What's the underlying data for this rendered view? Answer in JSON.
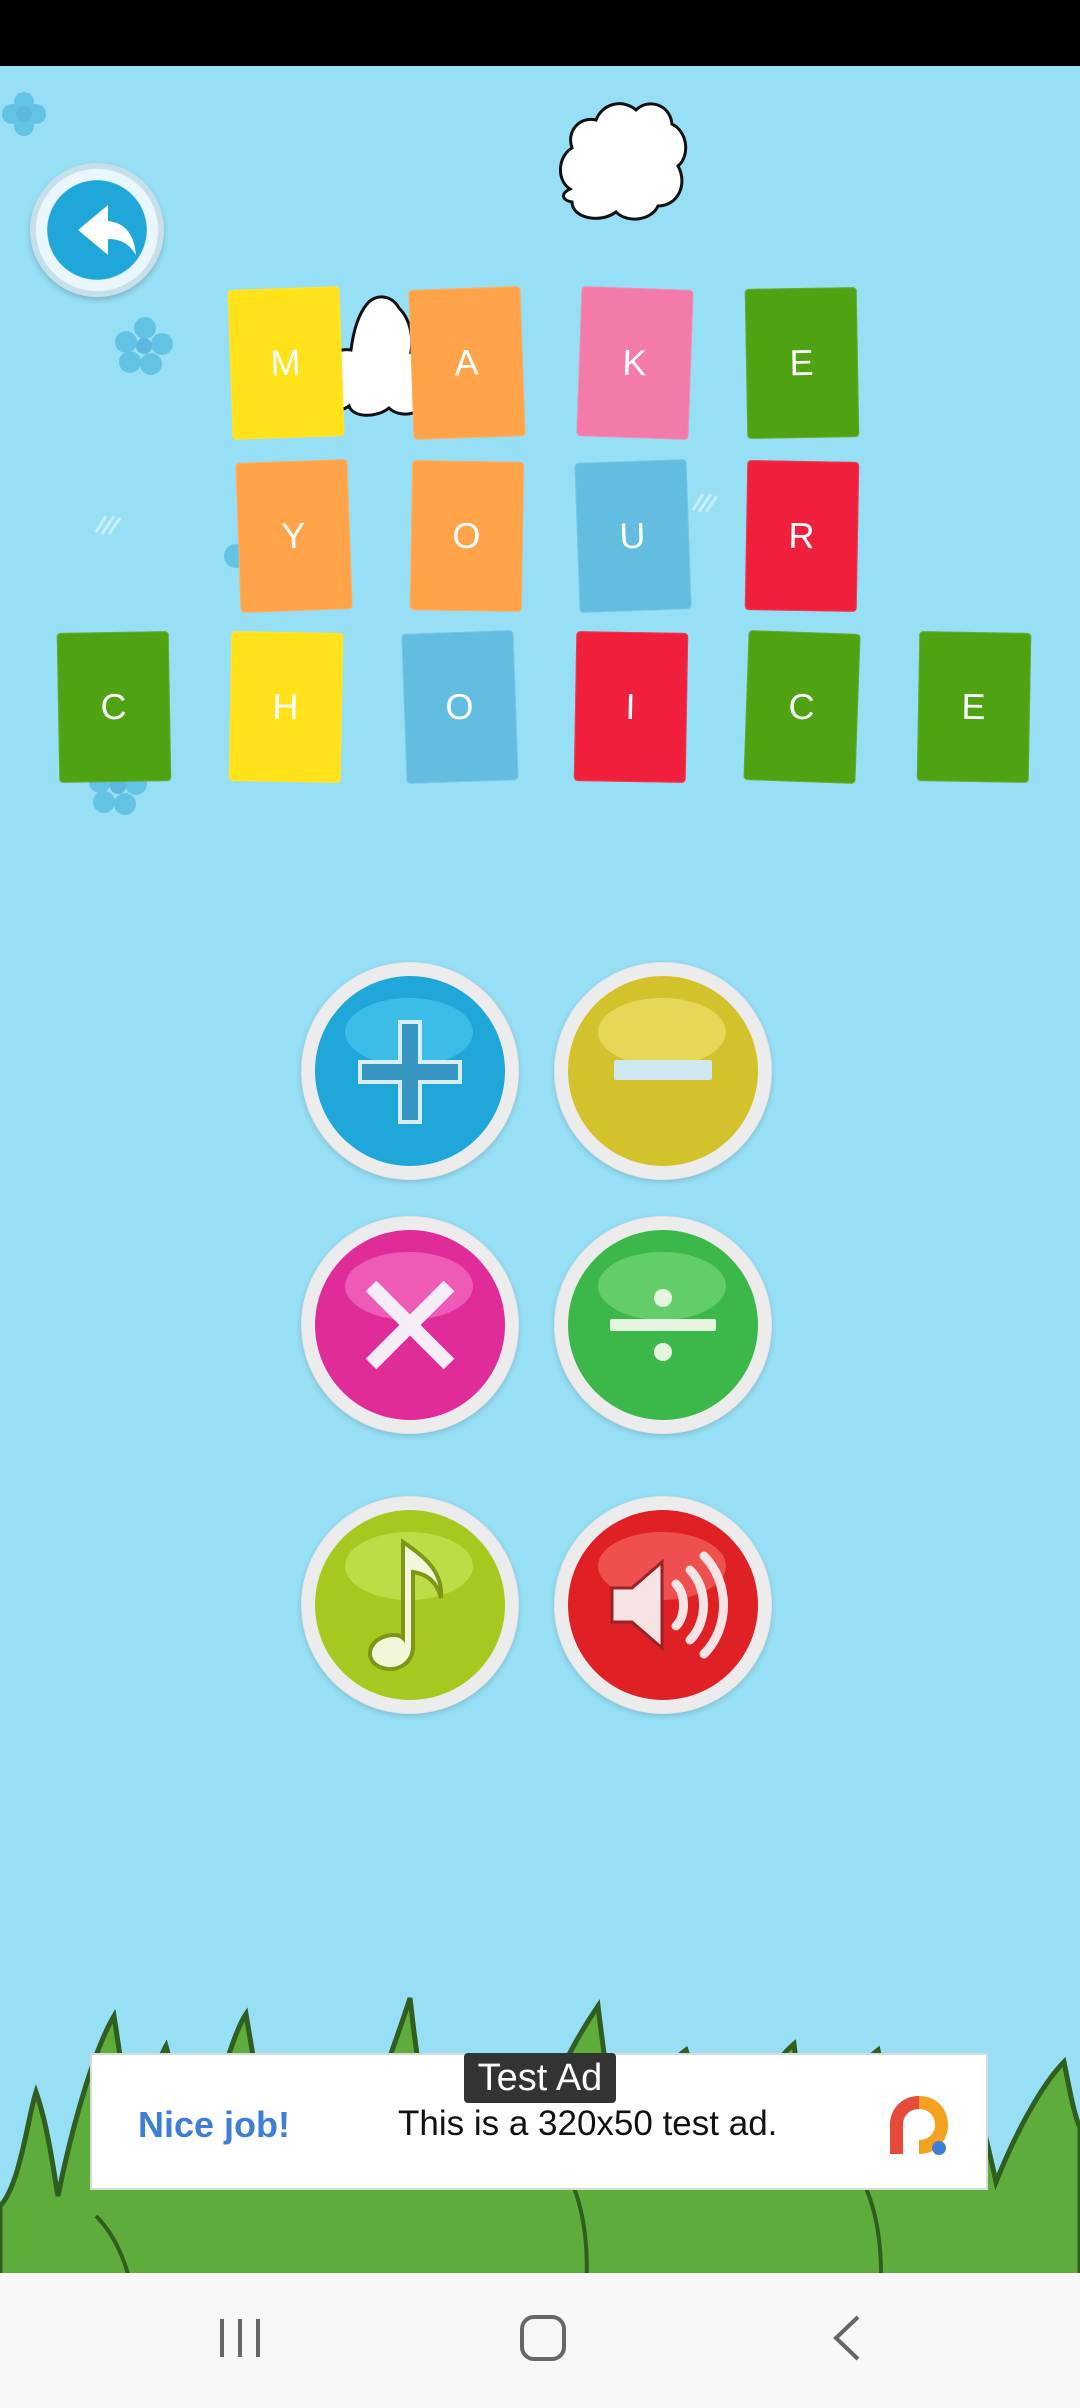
{
  "title_tiles": [
    {
      "letter": "M",
      "color": "yellow"
    },
    {
      "letter": "A",
      "color": "orange"
    },
    {
      "letter": "K",
      "color": "pink"
    },
    {
      "letter": "E",
      "color": "green"
    },
    {
      "letter": "Y",
      "color": "orange"
    },
    {
      "letter": "O",
      "color": "orange"
    },
    {
      "letter": "U",
      "color": "blue"
    },
    {
      "letter": "R",
      "color": "red"
    },
    {
      "letter": "C",
      "color": "green"
    },
    {
      "letter": "H",
      "color": "yellow"
    },
    {
      "letter": "O",
      "color": "blue"
    },
    {
      "letter": "I",
      "color": "red"
    },
    {
      "letter": "C",
      "color": "green"
    },
    {
      "letter": "E",
      "color": "green"
    }
  ],
  "buttons": {
    "back": "back-arrow-icon",
    "addition": "plus-icon",
    "subtraction": "minus-icon",
    "multiplication": "times-icon",
    "division": "divide-icon",
    "music": "music-note-icon",
    "sound": "speaker-icon"
  },
  "ad": {
    "label": "Test Ad",
    "cta": "Nice job!",
    "body": "This is a 320x50 test ad."
  },
  "colors": {
    "sky": "#97dff5",
    "addition": "#1ea7d8",
    "subtraction": "#d4c22c",
    "multiplication": "#e02c98",
    "division": "#3cb84a",
    "music": "#a6c920",
    "sound": "#df2025"
  }
}
